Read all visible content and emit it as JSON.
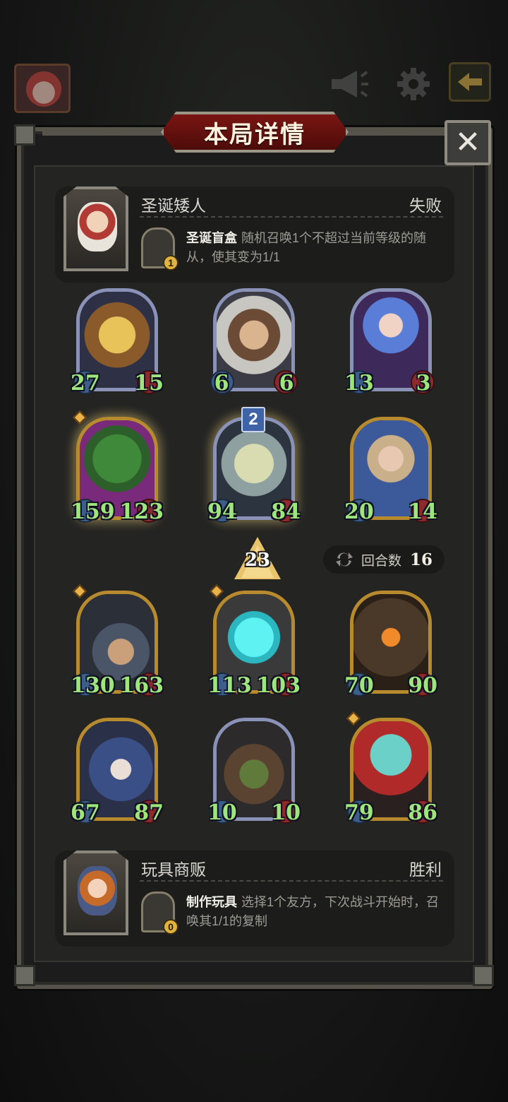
{
  "dialog": {
    "title": "本局详情",
    "close_label": "✕"
  },
  "opponent": {
    "hero_name": "圣诞矮人",
    "result": "失败",
    "power_name": "圣诞盲盒",
    "power_desc": "随机召唤1个不超过当前等级的随从，使其变为1/1",
    "power_cost": "1"
  },
  "player": {
    "hero_name": "玩具商贩",
    "result": "胜利",
    "power_name": "制作玩具",
    "power_desc": "选择1个友方，下次战斗开始时，召唤其1/1的复制",
    "power_cost": "0"
  },
  "opponent_board": [
    {
      "atk": "27",
      "hp": "15"
    },
    {
      "atk": "6",
      "hp": "6"
    },
    {
      "atk": "13",
      "hp": "3"
    },
    {
      "atk": "159",
      "hp": "123"
    },
    {
      "atk": "94",
      "hp": "84"
    },
    {
      "atk": "20",
      "hp": "14"
    }
  ],
  "tier_badge": "2",
  "level": "23",
  "turns": {
    "label": "回合数",
    "value": "16"
  },
  "player_board": [
    {
      "atk": "130",
      "hp": "163"
    },
    {
      "atk": "113",
      "hp": "103"
    },
    {
      "atk": "70",
      "hp": "90"
    },
    {
      "atk": "67",
      "hp": "87"
    },
    {
      "atk": "10",
      "hp": "10"
    },
    {
      "atk": "79",
      "hp": "86"
    }
  ]
}
